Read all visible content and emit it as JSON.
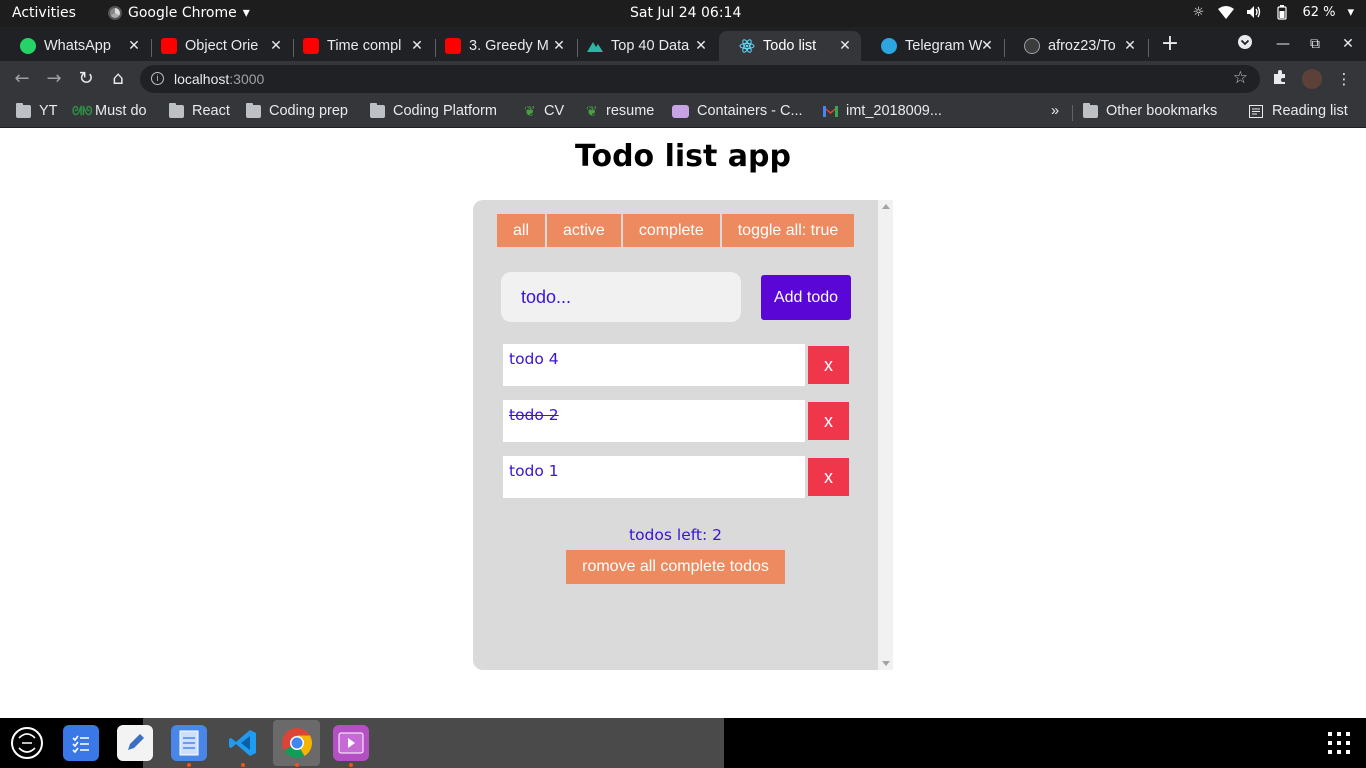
{
  "topbar": {
    "activities": "Activities",
    "app_name": "Google Chrome",
    "clock": "Sat Jul 24  06:14",
    "battery": "62 %"
  },
  "tabs": [
    {
      "title": "WhatsApp",
      "icon": "whatsapp-icon"
    },
    {
      "title": "Object Orie",
      "icon": "youtube-icon"
    },
    {
      "title": "Time compl",
      "icon": "youtube-icon"
    },
    {
      "title": "3. Greedy M",
      "icon": "youtube-icon"
    },
    {
      "title": "Top 40 Data",
      "icon": "mountain-icon"
    },
    {
      "title": "Todo list",
      "icon": "react-icon",
      "active": true
    },
    {
      "title": "Telegram W",
      "icon": "telegram-icon"
    },
    {
      "title": "afroz23/To",
      "icon": "github-icon"
    }
  ],
  "omnibox": {
    "host": "localhost",
    "port": ":3000"
  },
  "bookmarks": [
    {
      "label": "YT",
      "icon": "folder-icon"
    },
    {
      "label": "Must do",
      "icon": "gfg-icon"
    },
    {
      "label": "React",
      "icon": "folder-icon"
    },
    {
      "label": "Coding prep",
      "icon": "folder-icon"
    },
    {
      "label": "Coding Platform",
      "icon": "folder-icon"
    },
    {
      "label": "CV",
      "icon": "overleaf-icon"
    },
    {
      "label": "resume",
      "icon": "overleaf-icon"
    },
    {
      "label": "Containers - C...",
      "icon": "containers-icon"
    },
    {
      "label": "imt_2018009...",
      "icon": "gmail-icon"
    }
  ],
  "bookmarks_more": "»",
  "other_bookmarks": "Other bookmarks",
  "reading_list": "Reading list",
  "app": {
    "title": "Todo list app",
    "filters": [
      "all",
      "active",
      "complete",
      "toggle all: true"
    ],
    "input_placeholder": "todo...",
    "add_label": "Add todo",
    "todos": [
      {
        "text": "todo 4",
        "done": false
      },
      {
        "text": "todo 2",
        "done": true
      },
      {
        "text": "todo 1",
        "done": false
      }
    ],
    "delete_label": "x",
    "todos_left": "todos left: 2",
    "remove_complete_label": "romove all complete todos"
  },
  "colors": {
    "accent_orange": "#ee8a5f",
    "add_purple": "#5a06d6",
    "delete_red": "#f0364a",
    "text_purple": "#3b12d6",
    "card_bg": "#dadada"
  },
  "dock": [
    "ubuntu-logo-icon",
    "tasks-icon",
    "text-editor-icon",
    "files-icon",
    "vscode-icon",
    "chrome-icon",
    "media-player-icon"
  ]
}
